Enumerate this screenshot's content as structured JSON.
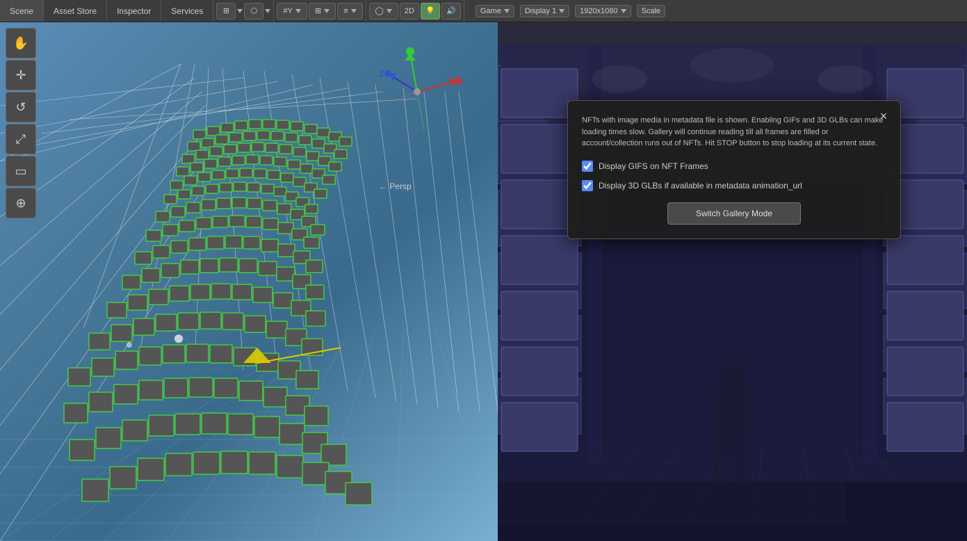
{
  "toolbar": {
    "tabs": [
      {
        "label": "Scene",
        "active": true
      },
      {
        "label": "Asset Store",
        "active": false
      },
      {
        "label": "Inspector",
        "active": false
      },
      {
        "label": "Services",
        "active": false
      }
    ],
    "tools": [
      {
        "icon": "⊞",
        "label": "rect-tool",
        "active": false
      },
      {
        "icon": "⊡",
        "label": "cube-tool",
        "active": false
      },
      {
        "icon": "#Y",
        "label": "y-axis",
        "active": false
      },
      {
        "icon": "⊞",
        "label": "grid-tool",
        "active": false
      },
      {
        "icon": "⊙",
        "label": "rect-tool-2",
        "active": false
      },
      {
        "icon": "2D",
        "label": "2d-button",
        "active": false
      },
      {
        "icon": "💡",
        "label": "light-button",
        "active": true
      },
      {
        "icon": "🔊",
        "label": "audio-button",
        "active": false
      }
    ]
  },
  "scene": {
    "title": "Scene",
    "persp_label": "← Persp"
  },
  "game": {
    "title": "Game",
    "display": "Display 1",
    "resolution": "1920x1080",
    "scale_label": "Scale"
  },
  "dialog": {
    "close_icon": "×",
    "message": "NFTs with image media in metadata file is shown. Enabling GIFs and 3D GLBs can make loading times slow. Gallery will continue reading till all frames are filled or account/collection runs out of NFTs. Hit STOP button to stop loading at its current state.",
    "checkbox1_label": "Display GIFS on NFT Frames",
    "checkbox1_checked": true,
    "checkbox2_label": "Display 3D GLBs if available in metadata animation_url",
    "checkbox2_checked": true,
    "switch_button_label": "Switch Gallery Mode"
  }
}
